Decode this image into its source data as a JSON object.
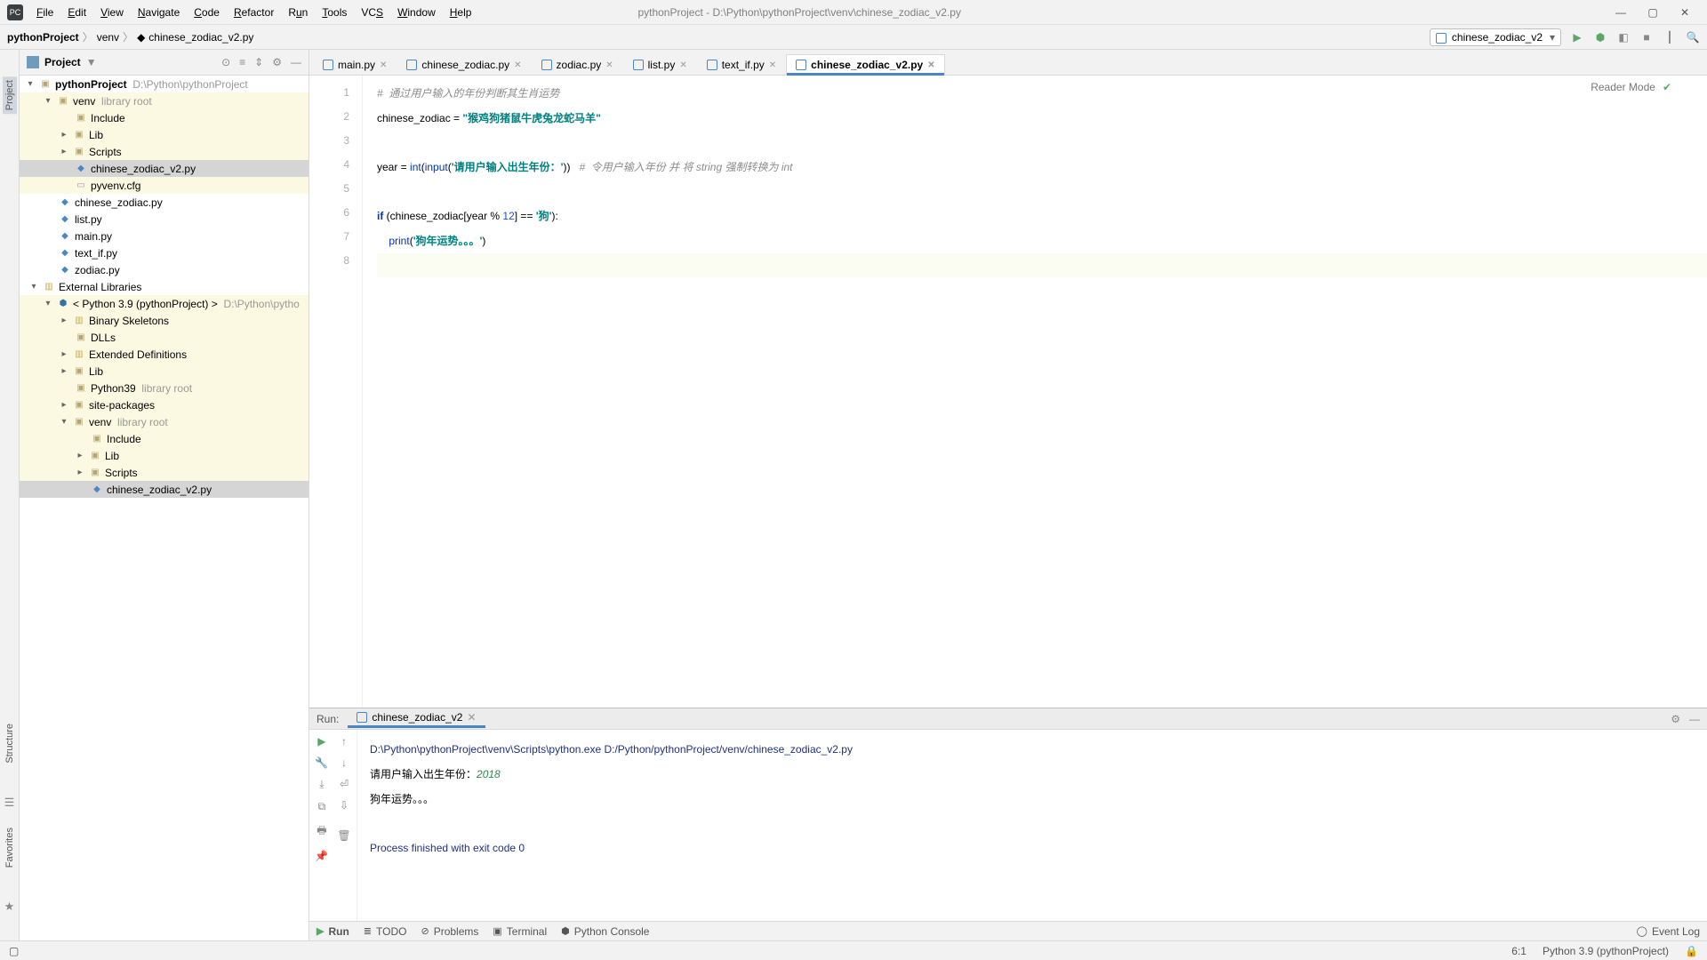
{
  "window": {
    "title_path": "pythonProject - D:\\Python\\pythonProject\\venv\\chinese_zodiac_v2.py"
  },
  "menu": {
    "file": "File",
    "edit": "Edit",
    "view": "View",
    "navigate": "Navigate",
    "code": "Code",
    "refactor": "Refactor",
    "run": "Run",
    "tools": "Tools",
    "vcs": "VCS",
    "window": "Window",
    "help": "Help"
  },
  "breadcrumbs": {
    "root": "pythonProject",
    "mid": "venv",
    "file": "chinese_zodiac_v2.py"
  },
  "runconfig": {
    "name": "chinese_zodiac_v2"
  },
  "leftTabs": {
    "project": "Project",
    "structure": "Structure",
    "favorites": "Favorites"
  },
  "projectPanel": {
    "title": "Project"
  },
  "tree": {
    "root": "pythonProject",
    "rootPath": "D:\\Python\\pythonProject",
    "venv": "venv",
    "libroot": "library root",
    "include": "Include",
    "lib": "Lib",
    "scripts": "Scripts",
    "czv2": "chinese_zodiac_v2.py",
    "pyvenv": "pyvenv.cfg",
    "cz": "chinese_zodiac.py",
    "listpy": "list.py",
    "mainpy": "main.py",
    "textif": "text_if.py",
    "zodiac": "zodiac.py",
    "extlib": "External Libraries",
    "py39": "< Python 3.9 (pythonProject) >",
    "py39path": "D:\\Python\\pytho",
    "binsk": "Binary Skeletons",
    "dlls": "DLLs",
    "extdef": "Extended Definitions",
    "lib2": "Lib",
    "python39": "Python39",
    "sitepkg": "site-packages",
    "venv2": "venv",
    "include2": "Include",
    "lib3": "Lib",
    "scripts2": "Scripts",
    "czv2b": "chinese_zodiac_v2.py"
  },
  "tabs": [
    {
      "label": "main.py",
      "active": false
    },
    {
      "label": "chinese_zodiac.py",
      "active": false
    },
    {
      "label": "zodiac.py",
      "active": false
    },
    {
      "label": "list.py",
      "active": false
    },
    {
      "label": "text_if.py",
      "active": false
    },
    {
      "label": "chinese_zodiac_v2.py",
      "active": true
    }
  ],
  "editor": {
    "reader": "Reader Mode",
    "gutter": [
      "1",
      "2",
      "3",
      "4",
      "5",
      "6",
      "7",
      "8"
    ],
    "l1_comment": "#  通过用户输入的年份判断其生肖运势",
    "l2_a": "chinese_zodiac = ",
    "l2_str": "\"猴鸡狗猪鼠牛虎兔龙蛇马羊\"",
    "l4_a": "year = ",
    "l4_int": "int",
    "l4_b": "(",
    "l4_input": "input",
    "l4_c": "(",
    "l4_str": "'请用户输入出生年份：'",
    "l4_d": "))   ",
    "l4_comment": "#  令用户输入年份 并 将 string 强制转换为 int",
    "l6_if": "if ",
    "l6_a": "(chinese_zodiac[year % ",
    "l6_num": "12",
    "l6_b": "] == ",
    "l6_str": "'狗'",
    "l6_c": "):",
    "l7_a": "    ",
    "l7_print": "print",
    "l7_b": "(",
    "l7_str": "'狗年运势。。。'",
    "l7_c": ")"
  },
  "run": {
    "label": "Run:",
    "tab": "chinese_zodiac_v2",
    "cmd": "D:\\Python\\pythonProject\\venv\\Scripts\\python.exe D:/Python/pythonProject/venv/chinese_zodiac_v2.py",
    "prompt": "请用户输入出生年份：",
    "input": "2018",
    "out": "狗年运势。。。",
    "end": "Process finished with exit code 0"
  },
  "bottomTabs": {
    "run": "Run",
    "todo": "TODO",
    "problems": "Problems",
    "terminal": "Terminal",
    "pyconsole": "Python Console",
    "eventlog": "Event Log"
  },
  "status": {
    "pos": "6:1",
    "interpreter": "Python 3.9 (pythonProject)"
  }
}
